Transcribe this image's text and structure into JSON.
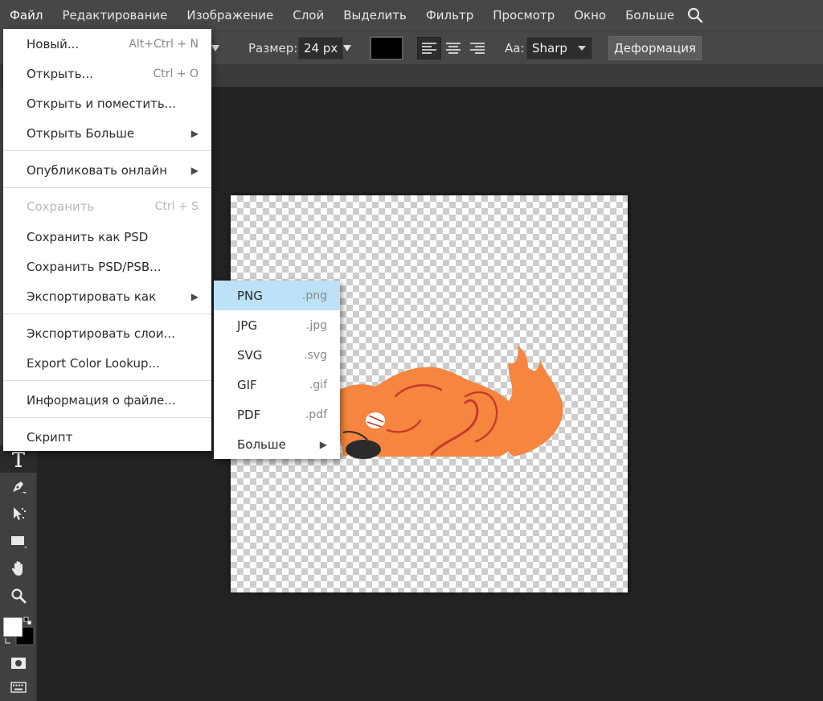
{
  "menubar": {
    "items": [
      "Файл",
      "Редактирование",
      "Изображение",
      "Слой",
      "Выделить",
      "Фильтр",
      "Просмотр",
      "Окно",
      "Больше"
    ],
    "search_icon": "search-icon"
  },
  "options": {
    "size_label": "Размер:",
    "size_value": "24 px",
    "color_swatch": "#000000",
    "aa_label": "Aa:",
    "aa_value": "Sharp",
    "warp_button": "Деформация"
  },
  "file_menu": {
    "items": [
      {
        "label": "Новый...",
        "shortcut": "Alt+Ctrl + N"
      },
      {
        "label": "Открыть...",
        "shortcut": "Ctrl + O"
      },
      {
        "label": "Открыть и поместить...",
        "shortcut": ""
      },
      {
        "label": "Открыть Больше",
        "submenu": true
      },
      {
        "label": "Опубликовать онлайн",
        "submenu": true
      },
      {
        "label": "Сохранить",
        "shortcut": "Ctrl + S",
        "disabled": true
      },
      {
        "label": "Сохранить как PSD",
        "shortcut": ""
      },
      {
        "label": "Сохранить PSD/PSB...",
        "shortcut": ""
      },
      {
        "label": "Экспортировать как",
        "submenu": true
      },
      {
        "label": "Экспортировать слои...",
        "shortcut": ""
      },
      {
        "label": "Export Color Lookup...",
        "shortcut": ""
      },
      {
        "label": "Информация о файле...",
        "shortcut": ""
      },
      {
        "label": "Скрипт",
        "shortcut": ""
      }
    ]
  },
  "export_submenu": {
    "items": [
      {
        "label": "PNG",
        "ext": ".png",
        "highlighted": true
      },
      {
        "label": "JPG",
        "ext": ".jpg"
      },
      {
        "label": "SVG",
        "ext": ".svg"
      },
      {
        "label": "GIF",
        "ext": ".gif"
      },
      {
        "label": "PDF",
        "ext": ".pdf"
      },
      {
        "label": "Больше",
        "submenu": true
      }
    ]
  },
  "toolbar": {
    "tools": [
      "type-tool-icon",
      "pen-tool-icon",
      "path-select-icon",
      "rectangle-tool-icon",
      "hand-tool-icon",
      "zoom-tool-icon"
    ]
  },
  "colors": {
    "menu_highlight": "#bde1f6",
    "squirrel_orange": "#f5853f",
    "squirrel_line": "#c63a2a"
  }
}
